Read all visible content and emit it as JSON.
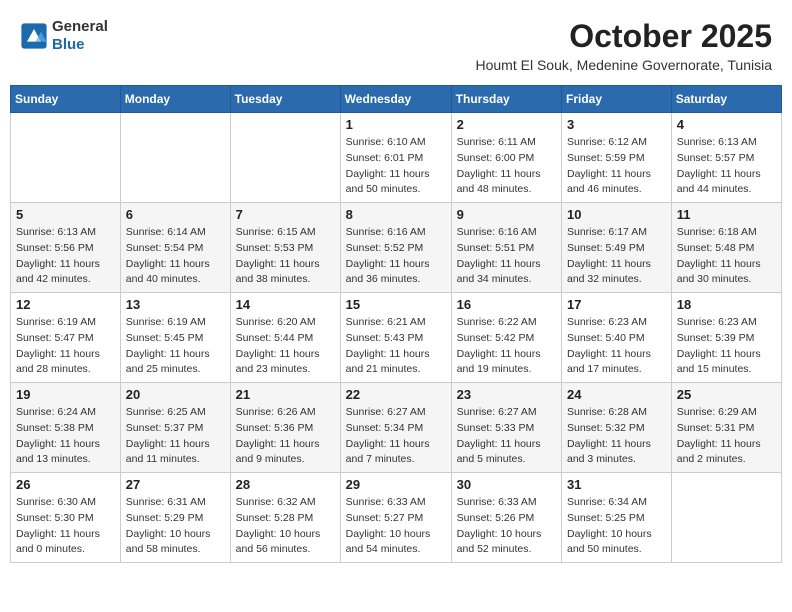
{
  "header": {
    "logo_general": "General",
    "logo_blue": "Blue",
    "month": "October 2025",
    "location": "Houmt El Souk, Medenine Governorate, Tunisia"
  },
  "days_of_week": [
    "Sunday",
    "Monday",
    "Tuesday",
    "Wednesday",
    "Thursday",
    "Friday",
    "Saturday"
  ],
  "weeks": [
    [
      {
        "day": "",
        "info": ""
      },
      {
        "day": "",
        "info": ""
      },
      {
        "day": "",
        "info": ""
      },
      {
        "day": "1",
        "info": "Sunrise: 6:10 AM\nSunset: 6:01 PM\nDaylight: 11 hours\nand 50 minutes."
      },
      {
        "day": "2",
        "info": "Sunrise: 6:11 AM\nSunset: 6:00 PM\nDaylight: 11 hours\nand 48 minutes."
      },
      {
        "day": "3",
        "info": "Sunrise: 6:12 AM\nSunset: 5:59 PM\nDaylight: 11 hours\nand 46 minutes."
      },
      {
        "day": "4",
        "info": "Sunrise: 6:13 AM\nSunset: 5:57 PM\nDaylight: 11 hours\nand 44 minutes."
      }
    ],
    [
      {
        "day": "5",
        "info": "Sunrise: 6:13 AM\nSunset: 5:56 PM\nDaylight: 11 hours\nand 42 minutes."
      },
      {
        "day": "6",
        "info": "Sunrise: 6:14 AM\nSunset: 5:54 PM\nDaylight: 11 hours\nand 40 minutes."
      },
      {
        "day": "7",
        "info": "Sunrise: 6:15 AM\nSunset: 5:53 PM\nDaylight: 11 hours\nand 38 minutes."
      },
      {
        "day": "8",
        "info": "Sunrise: 6:16 AM\nSunset: 5:52 PM\nDaylight: 11 hours\nand 36 minutes."
      },
      {
        "day": "9",
        "info": "Sunrise: 6:16 AM\nSunset: 5:51 PM\nDaylight: 11 hours\nand 34 minutes."
      },
      {
        "day": "10",
        "info": "Sunrise: 6:17 AM\nSunset: 5:49 PM\nDaylight: 11 hours\nand 32 minutes."
      },
      {
        "day": "11",
        "info": "Sunrise: 6:18 AM\nSunset: 5:48 PM\nDaylight: 11 hours\nand 30 minutes."
      }
    ],
    [
      {
        "day": "12",
        "info": "Sunrise: 6:19 AM\nSunset: 5:47 PM\nDaylight: 11 hours\nand 28 minutes."
      },
      {
        "day": "13",
        "info": "Sunrise: 6:19 AM\nSunset: 5:45 PM\nDaylight: 11 hours\nand 25 minutes."
      },
      {
        "day": "14",
        "info": "Sunrise: 6:20 AM\nSunset: 5:44 PM\nDaylight: 11 hours\nand 23 minutes."
      },
      {
        "day": "15",
        "info": "Sunrise: 6:21 AM\nSunset: 5:43 PM\nDaylight: 11 hours\nand 21 minutes."
      },
      {
        "day": "16",
        "info": "Sunrise: 6:22 AM\nSunset: 5:42 PM\nDaylight: 11 hours\nand 19 minutes."
      },
      {
        "day": "17",
        "info": "Sunrise: 6:23 AM\nSunset: 5:40 PM\nDaylight: 11 hours\nand 17 minutes."
      },
      {
        "day": "18",
        "info": "Sunrise: 6:23 AM\nSunset: 5:39 PM\nDaylight: 11 hours\nand 15 minutes."
      }
    ],
    [
      {
        "day": "19",
        "info": "Sunrise: 6:24 AM\nSunset: 5:38 PM\nDaylight: 11 hours\nand 13 minutes."
      },
      {
        "day": "20",
        "info": "Sunrise: 6:25 AM\nSunset: 5:37 PM\nDaylight: 11 hours\nand 11 minutes."
      },
      {
        "day": "21",
        "info": "Sunrise: 6:26 AM\nSunset: 5:36 PM\nDaylight: 11 hours\nand 9 minutes."
      },
      {
        "day": "22",
        "info": "Sunrise: 6:27 AM\nSunset: 5:34 PM\nDaylight: 11 hours\nand 7 minutes."
      },
      {
        "day": "23",
        "info": "Sunrise: 6:27 AM\nSunset: 5:33 PM\nDaylight: 11 hours\nand 5 minutes."
      },
      {
        "day": "24",
        "info": "Sunrise: 6:28 AM\nSunset: 5:32 PM\nDaylight: 11 hours\nand 3 minutes."
      },
      {
        "day": "25",
        "info": "Sunrise: 6:29 AM\nSunset: 5:31 PM\nDaylight: 11 hours\nand 2 minutes."
      }
    ],
    [
      {
        "day": "26",
        "info": "Sunrise: 6:30 AM\nSunset: 5:30 PM\nDaylight: 11 hours\nand 0 minutes."
      },
      {
        "day": "27",
        "info": "Sunrise: 6:31 AM\nSunset: 5:29 PM\nDaylight: 10 hours\nand 58 minutes."
      },
      {
        "day": "28",
        "info": "Sunrise: 6:32 AM\nSunset: 5:28 PM\nDaylight: 10 hours\nand 56 minutes."
      },
      {
        "day": "29",
        "info": "Sunrise: 6:33 AM\nSunset: 5:27 PM\nDaylight: 10 hours\nand 54 minutes."
      },
      {
        "day": "30",
        "info": "Sunrise: 6:33 AM\nSunset: 5:26 PM\nDaylight: 10 hours\nand 52 minutes."
      },
      {
        "day": "31",
        "info": "Sunrise: 6:34 AM\nSunset: 5:25 PM\nDaylight: 10 hours\nand 50 minutes."
      },
      {
        "day": "",
        "info": ""
      }
    ]
  ]
}
